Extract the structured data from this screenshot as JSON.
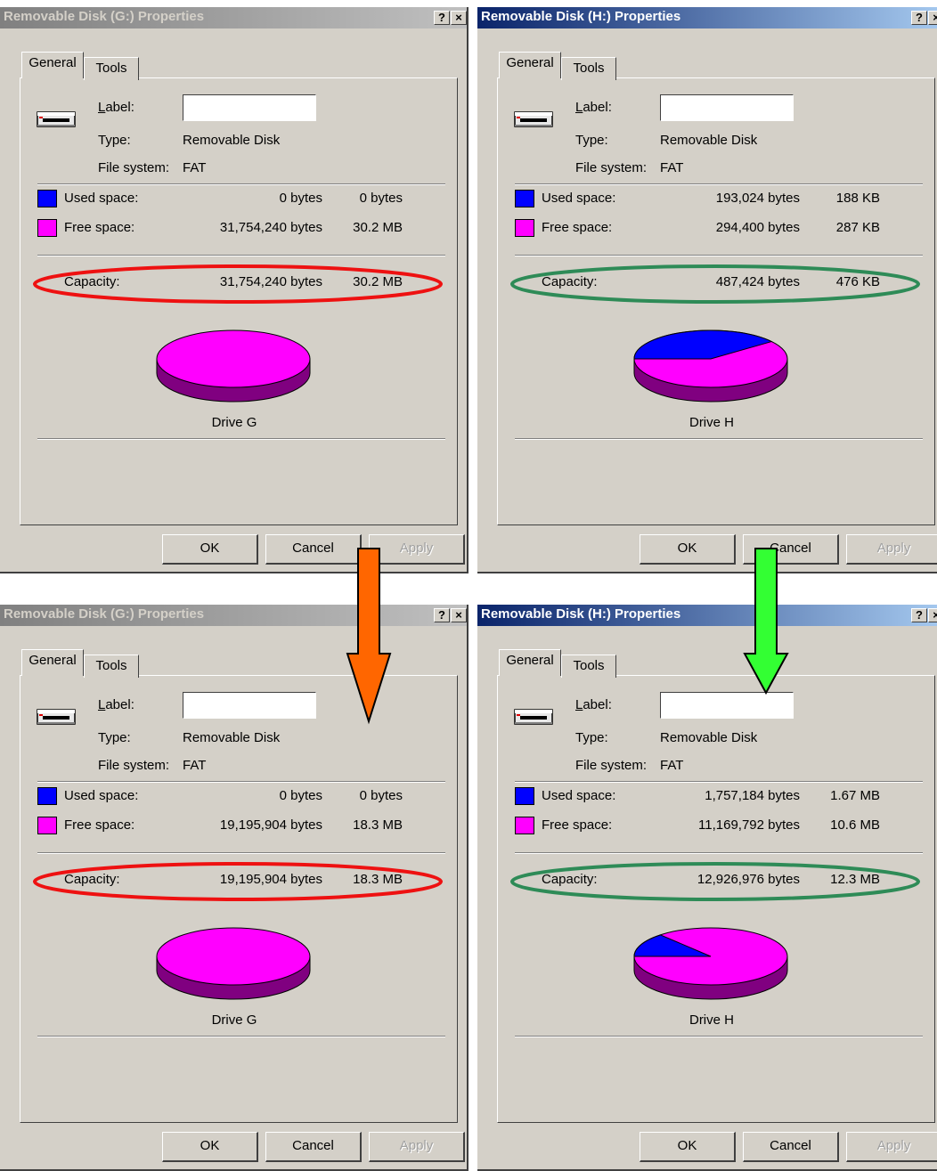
{
  "dialogs": [
    {
      "title": "Removable Disk (G:) Properties",
      "active": false,
      "tabs": [
        "General",
        "Tools"
      ],
      "label_caption": "Label:",
      "label_value": "",
      "type_caption": "Type:",
      "type_value": "Removable Disk",
      "fs_caption": "File system:",
      "fs_value": "FAT",
      "used_caption": "Used space:",
      "used_bytes": "0 bytes",
      "used_short": "0 bytes",
      "free_caption": "Free space:",
      "free_bytes": "31,754,240 bytes",
      "free_short": "30.2 MB",
      "capacity_caption": "Capacity:",
      "capacity_bytes": "31,754,240 bytes",
      "capacity_short": "30.2 MB",
      "drive_name": "Drive G",
      "used_fraction": 0,
      "buttons": {
        "ok": "OK",
        "cancel": "Cancel",
        "apply": "Apply"
      },
      "highlight_color": "#ee1111"
    },
    {
      "title": "Removable Disk (H:) Properties",
      "active": true,
      "tabs": [
        "General",
        "Tools"
      ],
      "label_caption": "Label:",
      "label_value": "",
      "type_caption": "Type:",
      "type_value": "Removable Disk",
      "fs_caption": "File system:",
      "fs_value": "FAT",
      "used_caption": "Used space:",
      "used_bytes": "193,024 bytes",
      "used_short": "188 KB",
      "free_caption": "Free space:",
      "free_bytes": "294,400 bytes",
      "free_short": "287 KB",
      "capacity_caption": "Capacity:",
      "capacity_bytes": "487,424 bytes",
      "capacity_short": "476 KB",
      "drive_name": "Drive H",
      "used_fraction": 0.396,
      "buttons": {
        "ok": "OK",
        "cancel": "Cancel",
        "apply": "Apply"
      },
      "highlight_color": "#2e8b57"
    },
    {
      "title": "Removable Disk (G:) Properties",
      "active": false,
      "tabs": [
        "General",
        "Tools"
      ],
      "label_caption": "Label:",
      "label_value": "",
      "type_caption": "Type:",
      "type_value": "Removable Disk",
      "fs_caption": "File system:",
      "fs_value": "FAT",
      "used_caption": "Used space:",
      "used_bytes": "0 bytes",
      "used_short": "0 bytes",
      "free_caption": "Free space:",
      "free_bytes": "19,195,904 bytes",
      "free_short": "18.3 MB",
      "capacity_caption": "Capacity:",
      "capacity_bytes": "19,195,904 bytes",
      "capacity_short": "18.3 MB",
      "drive_name": "Drive G",
      "used_fraction": 0,
      "buttons": {
        "ok": "OK",
        "cancel": "Cancel",
        "apply": "Apply"
      },
      "highlight_color": "#ee1111"
    },
    {
      "title": "Removable Disk (H:) Properties",
      "active": true,
      "tabs": [
        "General",
        "Tools"
      ],
      "label_caption": "Label:",
      "label_value": "",
      "type_caption": "Type:",
      "type_value": "Removable Disk",
      "fs_caption": "File system:",
      "fs_value": "FAT",
      "used_caption": "Used space:",
      "used_bytes": "1,757,184 bytes",
      "used_short": "1.67 MB",
      "free_caption": "Free space:",
      "free_bytes": "11,169,792 bytes",
      "free_short": "10.6 MB",
      "capacity_caption": "Capacity:",
      "capacity_bytes": "12,926,976 bytes",
      "capacity_short": "12.3 MB",
      "drive_name": "Drive H",
      "used_fraction": 0.136,
      "buttons": {
        "ok": "OK",
        "cancel": "Cancel",
        "apply": "Apply"
      },
      "highlight_color": "#2e8b57"
    }
  ],
  "titlebar_buttons": {
    "help": "?",
    "close": "×"
  },
  "colors": {
    "used": "#0000ff",
    "free": "#ff00ff",
    "pie_side": "#800080",
    "arrow_left": "#ff6600",
    "arrow_right": "#33ff33",
    "dialog_face": "#d4d0c8"
  }
}
